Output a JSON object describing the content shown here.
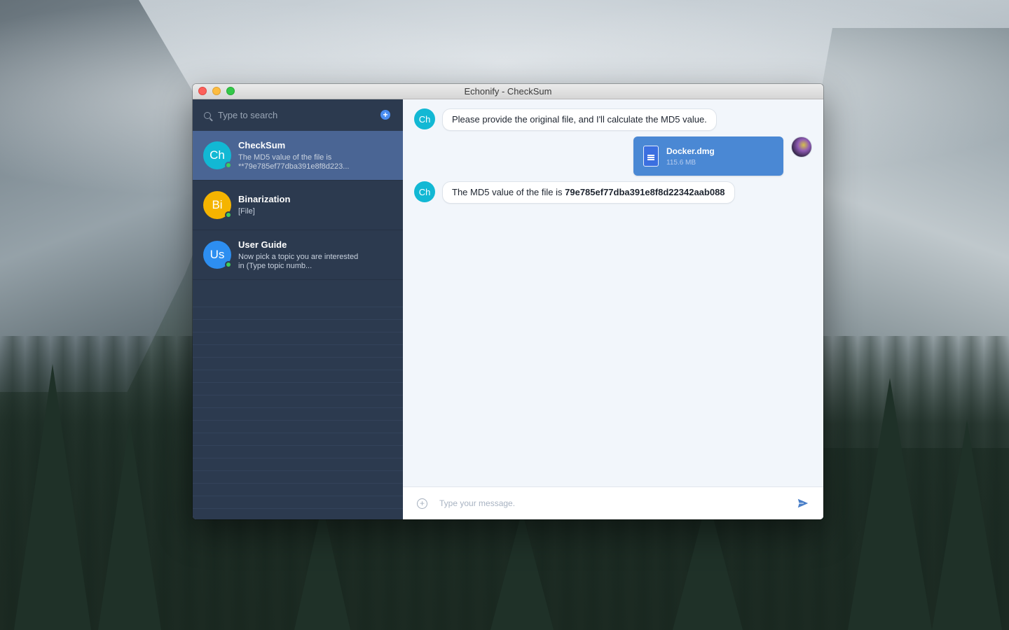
{
  "window": {
    "title": "Echonify - CheckSum"
  },
  "sidebar": {
    "search_placeholder": "Type to search",
    "conversations": [
      {
        "initials": "Ch",
        "name": "CheckSum",
        "preview": "The MD5 value of the file is **79e785ef77dba391e8f8d223...",
        "avatar_color": "#12b8d4",
        "online": true,
        "active": true
      },
      {
        "initials": "Bi",
        "name": "Binarization",
        "preview": "[File]",
        "avatar_color": "#f5b400",
        "online": true,
        "active": false
      },
      {
        "initials": "Us",
        "name": "User Guide",
        "preview": "Now pick a topic you are interested in (Type topic numb...",
        "avatar_color": "#2d8ef0",
        "online": true,
        "active": false
      }
    ]
  },
  "chat": {
    "messages": [
      {
        "from": "bot",
        "initials": "Ch",
        "text": "Please provide the original file, and I'll calculate the MD5 value."
      },
      {
        "from": "user",
        "type": "file",
        "file_name": "Docker.dmg",
        "file_size": "115.6 MB"
      },
      {
        "from": "bot",
        "initials": "Ch",
        "text_prefix": "The MD5 value of the file is ",
        "text_bold": "79e785ef77dba391e8f8d22342aab088"
      }
    ],
    "composer_placeholder": "Type your message."
  },
  "colors": {
    "sidebar_bg": "#2c3a4f",
    "active_item": "#4a6594",
    "accent": "#4a88d4",
    "online": "#3fcf5a"
  }
}
